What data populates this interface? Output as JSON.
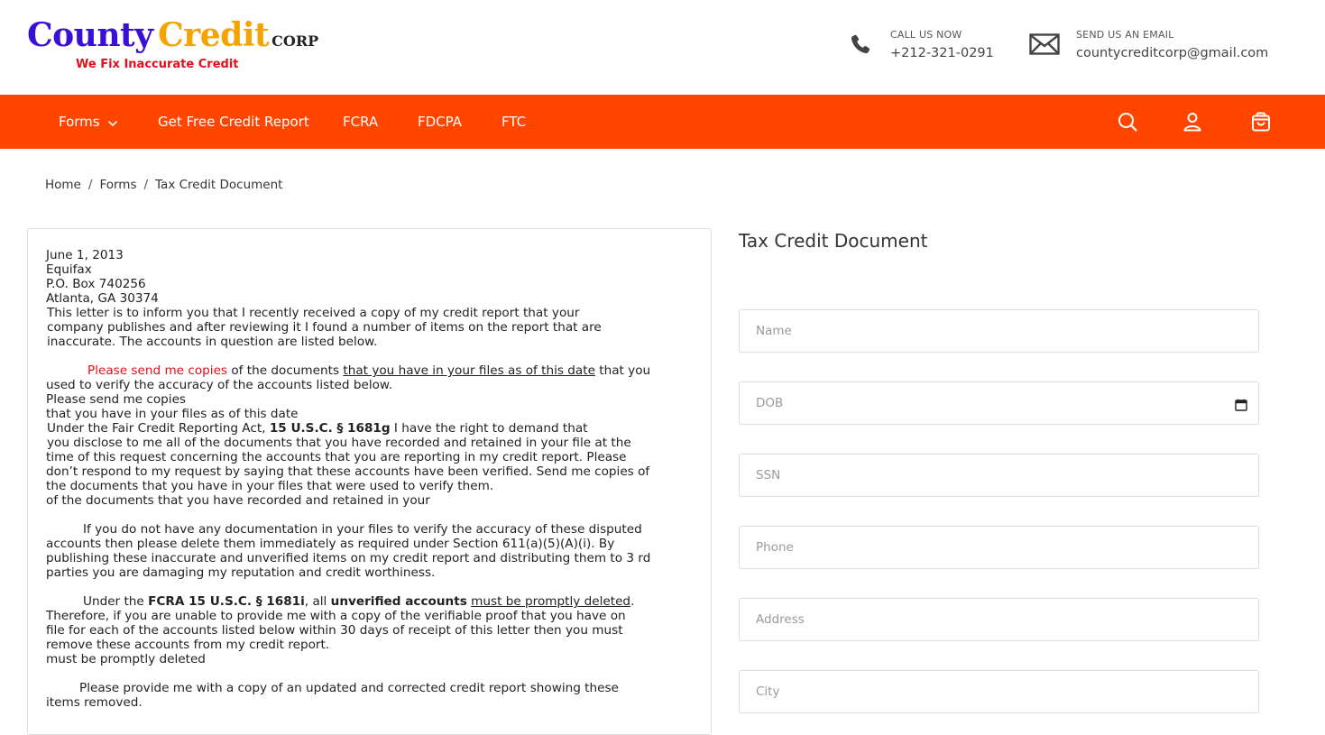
{
  "header": {
    "logo": {
      "county": "County",
      "credit": "Credit",
      "corp": "CORP",
      "tagline": "We Fix Inaccurate Credit"
    },
    "phone": {
      "label": "CALL US NOW",
      "value": "+212-321-0291",
      "icon": "phone-icon"
    },
    "email": {
      "label": "SEND US AN EMAIL",
      "value": "countycreditcorp@gmail.com",
      "icon": "envelope-icon"
    }
  },
  "nav": {
    "items": [
      "Forms",
      "Get Free Credit Report",
      "FCRA",
      "FDCPA",
      "FTC"
    ],
    "icons": [
      "search-icon",
      "user-icon",
      "cart-icon"
    ],
    "color": "#ff4500"
  },
  "breadcrumb": {
    "home": "Home",
    "forms": "Forms",
    "current": "Tax Credit Document"
  },
  "letter": {
    "date": "June 1, 2013",
    "addr1": "Equifax",
    "addr2": "P.O. Box 740256",
    "addr3": "Atlanta, GA 30374",
    "p1_l1": "This letter is to inform you that I recently received a copy of my credit report that your",
    "p1_l2": "company publishes and after reviewing it I found a number of items on the report that are",
    "p1_l3": "inaccurate. The accounts in question are listed below.",
    "p2_red": "Please send me copies",
    "p2_mid": " of the documents ",
    "p2_u": "that you have in your files as of this date",
    "p2_end": " that you",
    "p2_l2": "used to verify the accuracy of the accounts listed below.",
    "p2_l3": "Please send me copies",
    "p2_l4": "that you have in your files as of this date",
    "p3_a": "Under the Fair Credit Reporting Act, ",
    "p3_b": "15 U.S.C. § 1681g",
    "p3_c": " I have the right to demand that",
    "p3_l2": "you disclose to me all of the documents that you have recorded and retained in your file at the",
    "p3_l3": "time of this request concerning the accounts that you are reporting in my credit report. Please",
    "p3_l4": "don’t respond to my request by saying that these accounts have been verified. Send me copies of",
    "p3_l5": "the documents that you have in your files that were used to verify them.",
    "p3_l6": "of the documents that you have recorded and retained in your",
    "p4_l1": "If you do not have any documentation in your files to verify the accuracy of these disputed",
    "p4_l2": "accounts then please delete them immediately as required under Section 611(a)(5)(A)(i). By",
    "p4_l3": "publishing these inaccurate and unverified items on my credit report and distributing them to 3 rd",
    "p4_l4": "parties you are damaging my reputation and credit worthiness.",
    "p5_a": "Under the ",
    "p5_b": "FCRA 15 U.S.C. § 1681i",
    "p5_c": ", all ",
    "p5_d": "unverified accounts",
    "p5_e": " ",
    "p5_f": "must be promptly deleted",
    "p5_g": ".",
    "p5_l2": "Therefore, if you are unable to provide me with a copy of the verifiable proof that you have on",
    "p5_l3": "file for each of the accounts listed below within 30 days of receipt of this letter then you must",
    "p5_l4": "remove these accounts from my credit report.",
    "p5_l5": "must be promptly deleted",
    "p6_l1": "Please provide me with a copy of an updated and corrected credit report showing these",
    "p6_l2": "items removed."
  },
  "form": {
    "title": "Tax Credit Document",
    "fields": [
      {
        "placeholder": "Name"
      },
      {
        "placeholder": "DOB"
      },
      {
        "placeholder": "SSN"
      },
      {
        "placeholder": "Phone"
      },
      {
        "placeholder": "Address"
      },
      {
        "placeholder": "City"
      }
    ]
  }
}
